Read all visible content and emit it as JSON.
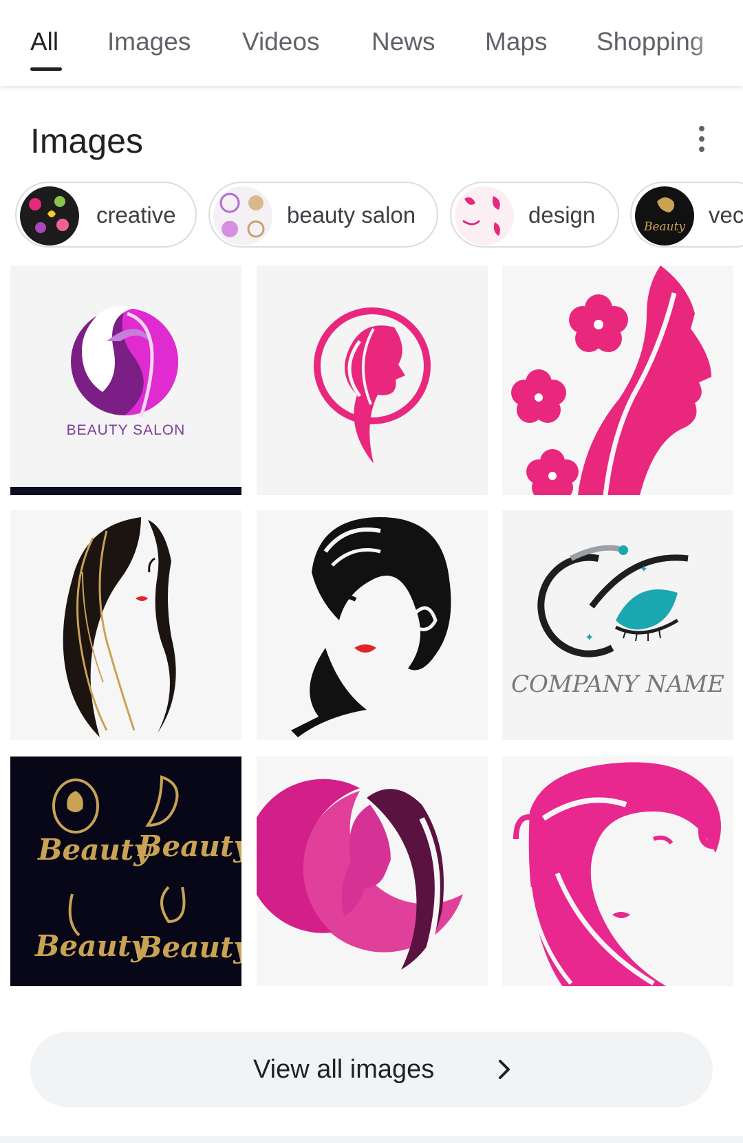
{
  "tabs": [
    {
      "label": "All",
      "active": true
    },
    {
      "label": "Images"
    },
    {
      "label": "Videos"
    },
    {
      "label": "News"
    },
    {
      "label": "Maps"
    },
    {
      "label": "Shopping"
    }
  ],
  "section": {
    "title": "Images",
    "more_icon": "more-vert-icon"
  },
  "chips": [
    {
      "label": "creative"
    },
    {
      "label": "beauty salon"
    },
    {
      "label": "design"
    },
    {
      "label": "vec"
    }
  ],
  "images": [
    {
      "caption": "BEAUTY SALON"
    },
    {},
    {},
    {},
    {},
    {
      "caption": "COMPANY NAME"
    },
    {
      "labels": [
        "Beauty",
        "Beauty",
        "Beauty",
        "Beauty"
      ]
    },
    {},
    {}
  ],
  "chip_thumb_text": "Beauty",
  "view_all": {
    "label": "View all images",
    "icon": "chevron-right-icon"
  },
  "colors": {
    "pink": "#e8277d",
    "magenta": "#d81b9a",
    "purple": "#7b1f86",
    "gold": "#c9a253",
    "navy": "#0a0a1f",
    "teal": "#1ba7b0"
  }
}
